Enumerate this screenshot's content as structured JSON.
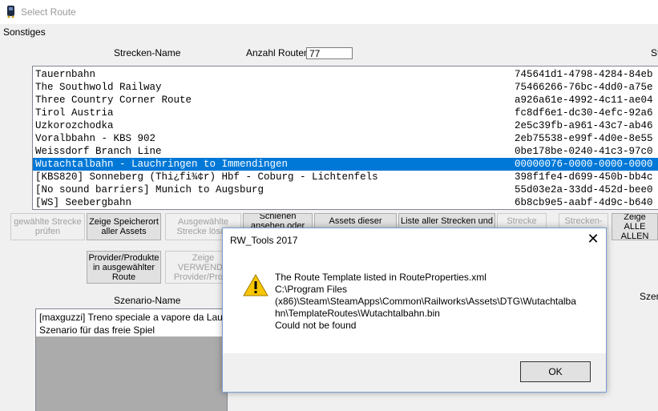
{
  "window": {
    "title": "Select Route"
  },
  "menu": {
    "items": [
      "Sonstiges"
    ]
  },
  "header": {
    "route_name_label": "Strecken-Name",
    "route_count_label": "Anzahl Routen",
    "route_count_value": "77",
    "right_label": "St"
  },
  "routes": [
    {
      "name": "Tauernbahn",
      "guid": "745641d1-4798-4284-84eb"
    },
    {
      "name": "The Southwold Railway",
      "guid": "75466266-76bc-4dd0-a75e"
    },
    {
      "name": "Three Country Corner Route",
      "guid": "a926a61e-4992-4c11-ae04"
    },
    {
      "name": "Tirol Austria",
      "guid": "fc8df6e1-dc30-4efc-92a6"
    },
    {
      "name": "Uzkorozchodka",
      "guid": "2e5c39fb-a961-43c7-ab46"
    },
    {
      "name": "Voralbbahn - KBS 902",
      "guid": "2eb75538-e99f-4d0e-8e55"
    },
    {
      "name": "Weissdorf Branch Line",
      "guid": "0be178be-0240-41c3-97c0"
    },
    {
      "name": "Wutachtalbahn - Lauchringen to Immendingen",
      "guid": "00000076-0000-0000-0000",
      "selected": true
    },
    {
      "name": "[KBS820] Sonneberg (Thi¿fi¾¢r) Hbf - Coburg - Lichtenfels",
      "guid": "398f1fe4-d699-450b-bb4c"
    },
    {
      "name": "[No sound barriers] Munich to Augsburg",
      "guid": "55d03e2a-33dd-452d-bee0"
    },
    {
      "name": "[WS] Seebergbahn",
      "guid": "6b8cb9e5-aabf-4d9c-b640"
    }
  ],
  "buttons": {
    "check_route": "gewählte Strecke\nprüfen",
    "show_storage": "Zeige Speicherort\naller Assets",
    "delete_route": "Ausgewählte\nStrecke lösch",
    "rails": "Schienen\nansehen oder",
    "assets_this": "Assets dieser",
    "list_all": "Liste aller Strecken und",
    "route": "Strecke",
    "route2": "Strecken-",
    "show_all": "Zeige ALLE\nALLEN",
    "provider_products": "Provider/Produkte\nin ausgewählter\nRoute",
    "show_used": "Zeige\nVERWENDE\nProvider/Produ"
  },
  "scenario": {
    "label": "Szenario-Name",
    "right_label": "Szen",
    "items": [
      "[maxguzzi] Treno speciale a vapore da Lauchrin",
      "Szenario für das freie Spiel"
    ]
  },
  "dialog": {
    "title": "RW_Tools 2017",
    "close": "✕",
    "icon": "warning-icon",
    "message": [
      "The Route Template listed in RouteProperties.xml",
      "C:\\Program Files",
      "(x86)\\Steam\\SteamApps\\Common\\Railworks\\Assets\\DTG\\Wutachtalba",
      "hn\\TemplateRoutes\\Wutachtalbahn.bin",
      "Could not be found"
    ],
    "ok_label": "OK"
  },
  "colors": {
    "selection": "#0078d7",
    "warning": "#f7c600"
  }
}
